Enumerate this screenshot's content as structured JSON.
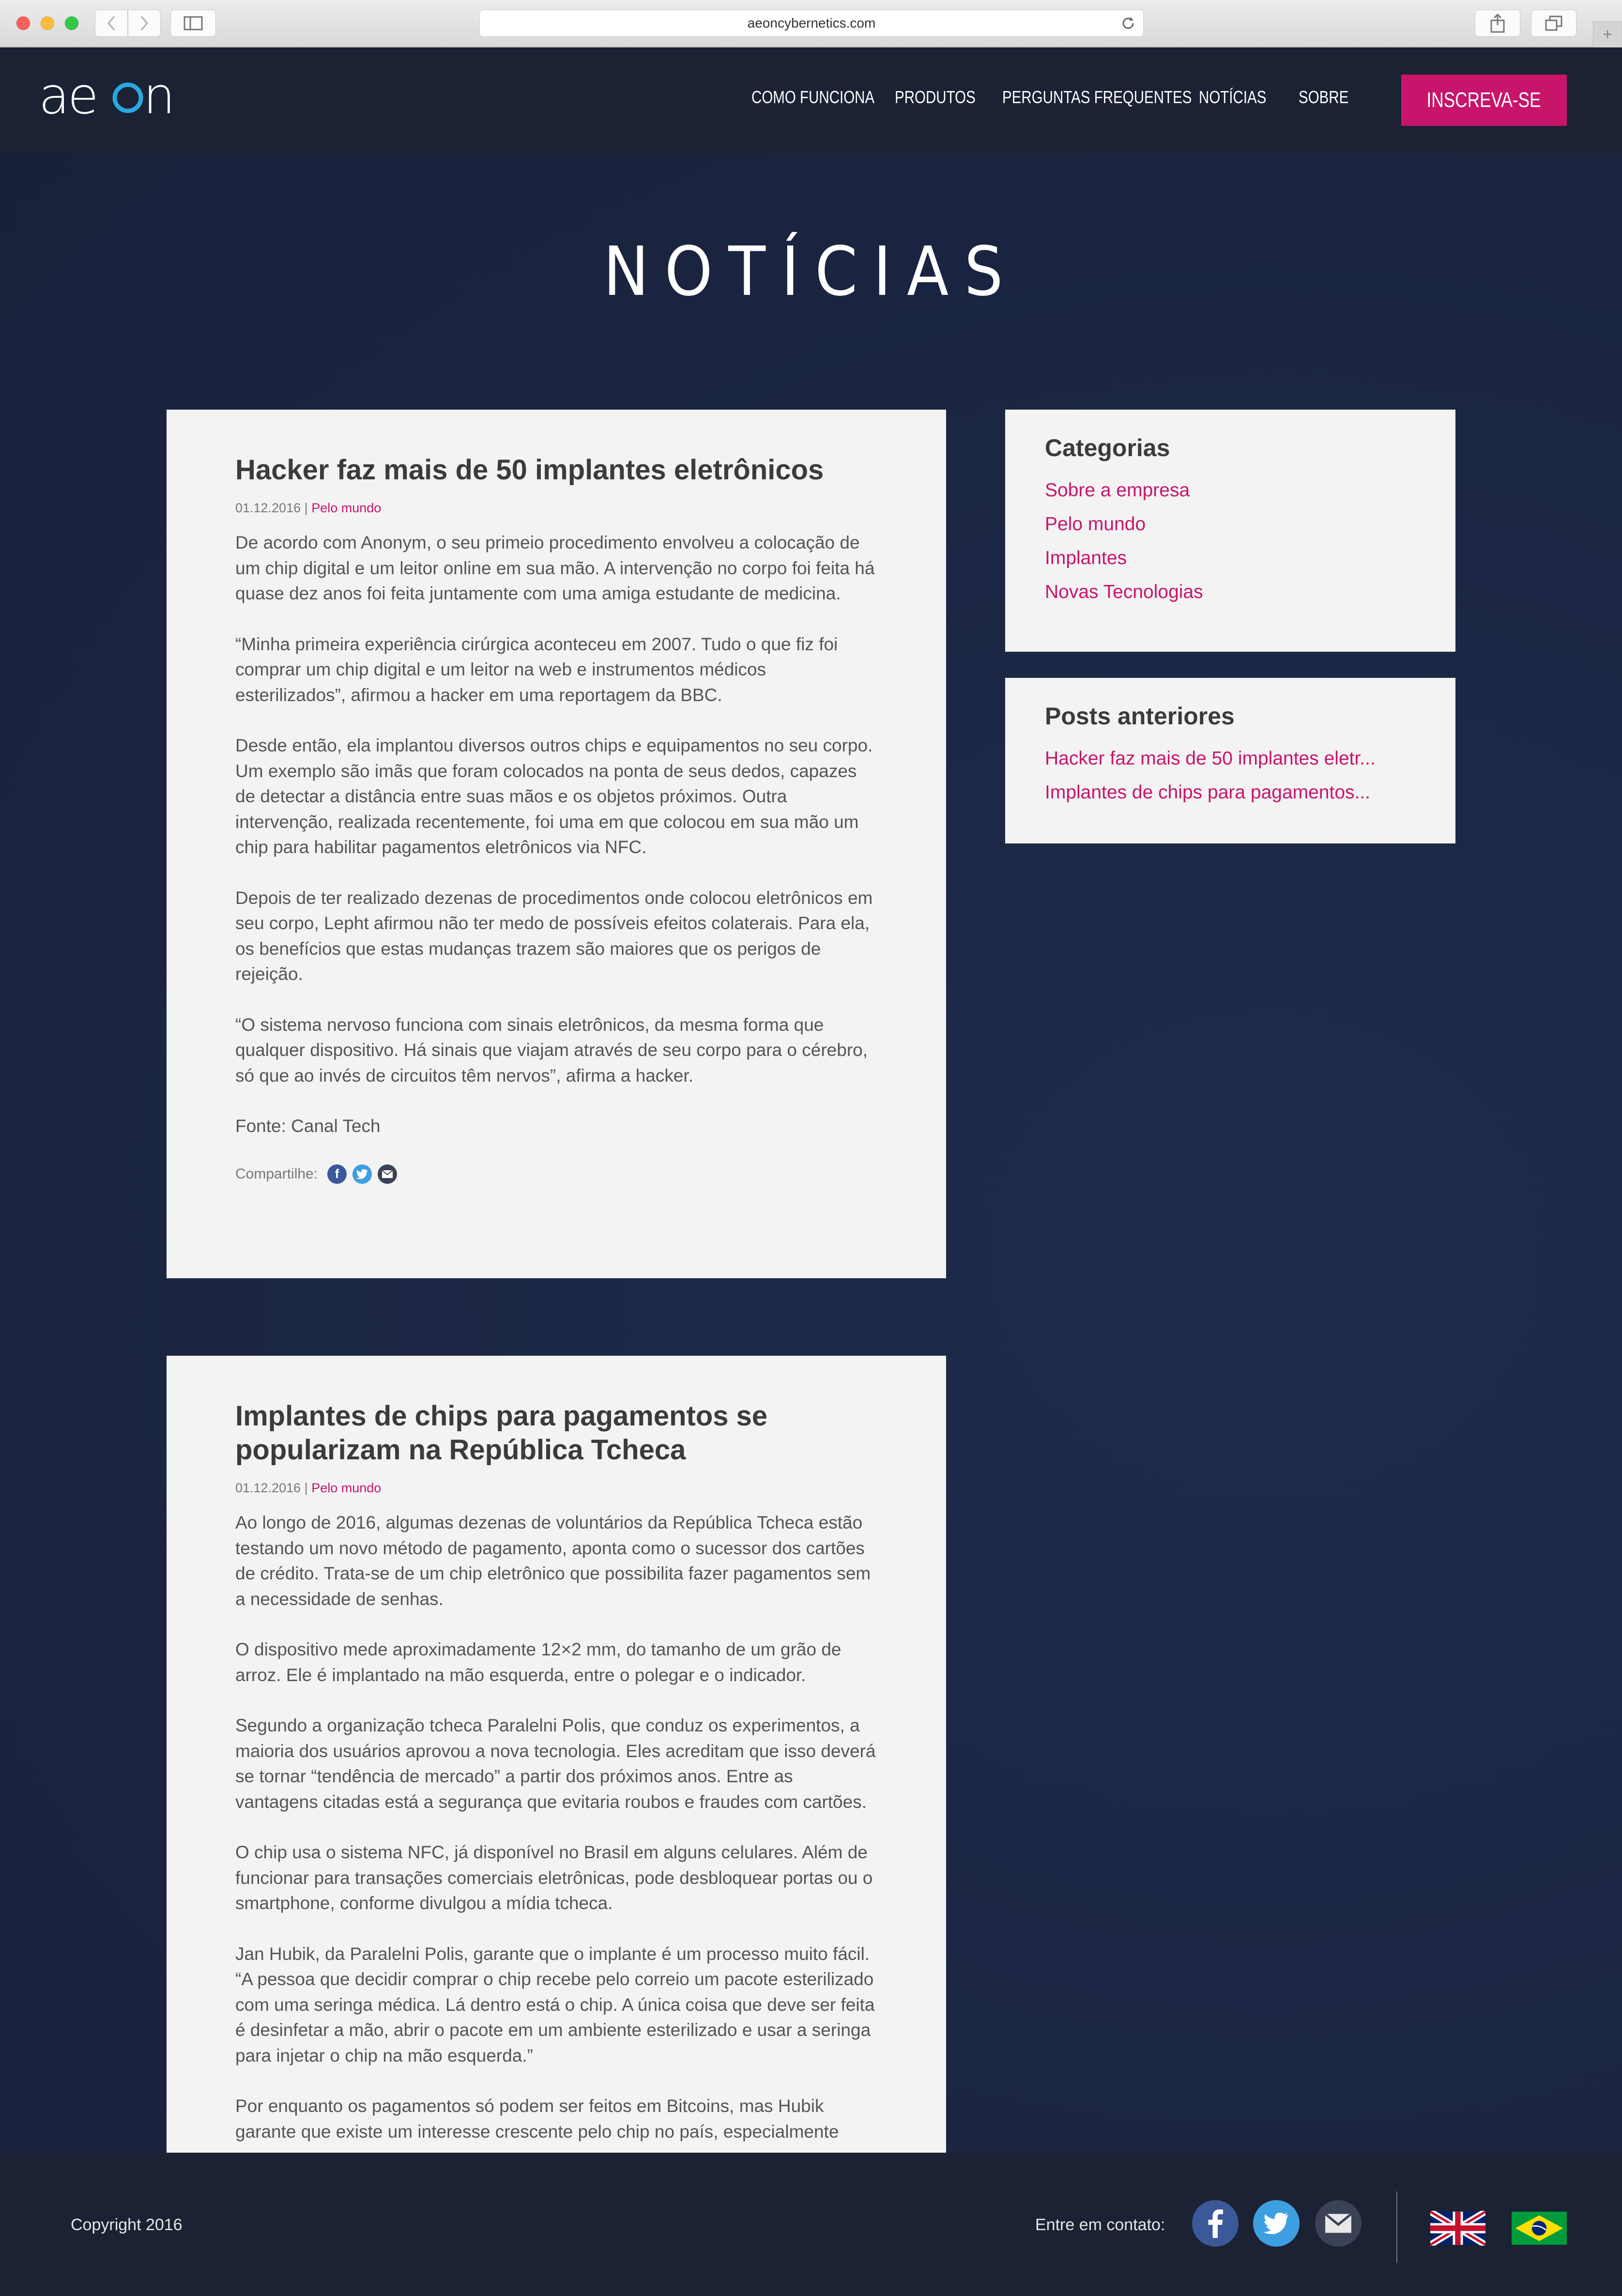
{
  "browser": {
    "url": "aeoncybernetics.com"
  },
  "header": {
    "logo_text": "aeon",
    "nav": [
      "COMO FUNCIONA",
      "PRODUTOS",
      "PERGUNTAS FREQUENTES",
      "NOTÍCIAS",
      "SOBRE"
    ],
    "cta": "INSCREVA-SE"
  },
  "page": {
    "title": "NOTÍCIAS"
  },
  "articles": [
    {
      "title": "Hacker faz mais de 50 implantes eletrônicos",
      "date": "01.12.2016",
      "separator": "|",
      "category": "Pelo mundo",
      "paragraphs": [
        "De acordo com Anonym, o seu primeio procedimento envolveu a colocação de um chip digital e um leitor online em sua mão. A intervenção no corpo foi feita há quase dez anos foi feita juntamente com uma amiga estudante de medicina.",
        "“Minha primeira experiência cirúrgica aconteceu em 2007. Tudo o que fiz foi comprar um chip digital e um leitor na web e instrumentos médicos esterilizados”, afirmou a hacker em uma reportagem da BBC.",
        "Desde então, ela implantou diversos outros chips e equipamentos no seu corpo. Um exemplo são imãs que foram colocados na ponta de seus dedos, capazes de detectar a distância entre suas mãos e os objetos próximos. Outra intervenção, realizada recentemente, foi uma em que colocou em sua mão um chip para habilitar pagamentos eletrônicos via NFC.",
        "Depois de ter realizado dezenas de procedimentos onde colocou eletrônicos em seu corpo, Lepht afirmou não ter medo de possíveis efeitos colaterais. Para ela, os benefícios que estas mudanças trazem são maiores que os perigos de rejeição.",
        "“O sistema nervoso funciona com sinais eletrônicos, da mesma forma que qualquer dispositivo. Há sinais que viajam através de seu corpo para o cérebro, só que ao invés de circuitos têm nervos”, afirma a hacker.",
        "Fonte: Canal Tech"
      ],
      "share_label": "Compartilhe:"
    },
    {
      "title": "Implantes de chips para pagamentos se popularizam na República Tcheca",
      "date": "01.12.2016",
      "separator": "|",
      "category": "Pelo mundo",
      "paragraphs": [
        "Ao longo de 2016, algumas dezenas de voluntários da República Tcheca estão testando um novo método de pagamento, aponta como o sucessor dos cartões de crédito. Trata-se de um chip eletrônico que possibilita fazer pagamentos sem a necessidade de senhas.",
        "O dispositivo mede aproximadamente 12×2 mm, do tamanho de um grão de arroz. Ele é implantado na mão esquerda, entre o polegar e o indicador.",
        "Segundo a organização tcheca Paralelni Polis, que conduz os experimentos, a maioria dos usuários aprovou a nova tecnologia. Eles acreditam que isso deverá se tornar “tendência de mercado” a partir dos próximos anos. Entre as vantagens citadas está a segurança que evitaria roubos e fraudes com cartões.",
        "O chip usa o sistema NFC, já disponível no Brasil em alguns celulares. Além de funcionar para transações comerciais eletrônicas, pode desbloquear portas ou o smartphone, conforme divulgou a mídia tcheca.",
        "Jan Hubik, da Paralelni Polis, garante que o implante é um processo muito fácil. “A pessoa que decidir comprar o chip recebe pelo correio um pacote esterilizado com uma seringa médica. Lá dentro está o chip. A única coisa que deve ser feita é desinfetar a mão, abrir o pacote em um ambiente esterilizado e usar a seringa para injetar o chip na mão esquerda.”",
        "Por enquanto os pagamentos só podem ser feitos em Bitcoins, mas Hubik garante que existe um interesse crescente pelo chip no país, especialmente"
      ]
    }
  ],
  "sidebar": {
    "categories": {
      "title": "Categorias",
      "items": [
        "Sobre a empresa",
        "Pelo mundo",
        "Implantes",
        "Novas Tecnologias"
      ]
    },
    "previous_posts": {
      "title": "Posts anteriores",
      "items": [
        "Hacker faz mais de 50 implantes eletr...",
        "Implantes de chips para pagamentos..."
      ]
    }
  },
  "footer": {
    "copyright": "Copyright 2016",
    "contact_label": "Entre em contato:"
  },
  "colors": {
    "accent": "#c8156b",
    "header_bg": "#1a2234",
    "main_bg": "#1c2745",
    "card_bg": "#f3f3f3",
    "logo_accent": "#29a8e0"
  },
  "icons": [
    "facebook-icon",
    "twitter-icon",
    "email-icon",
    "uk-flag-icon",
    "brazil-flag-icon"
  ]
}
